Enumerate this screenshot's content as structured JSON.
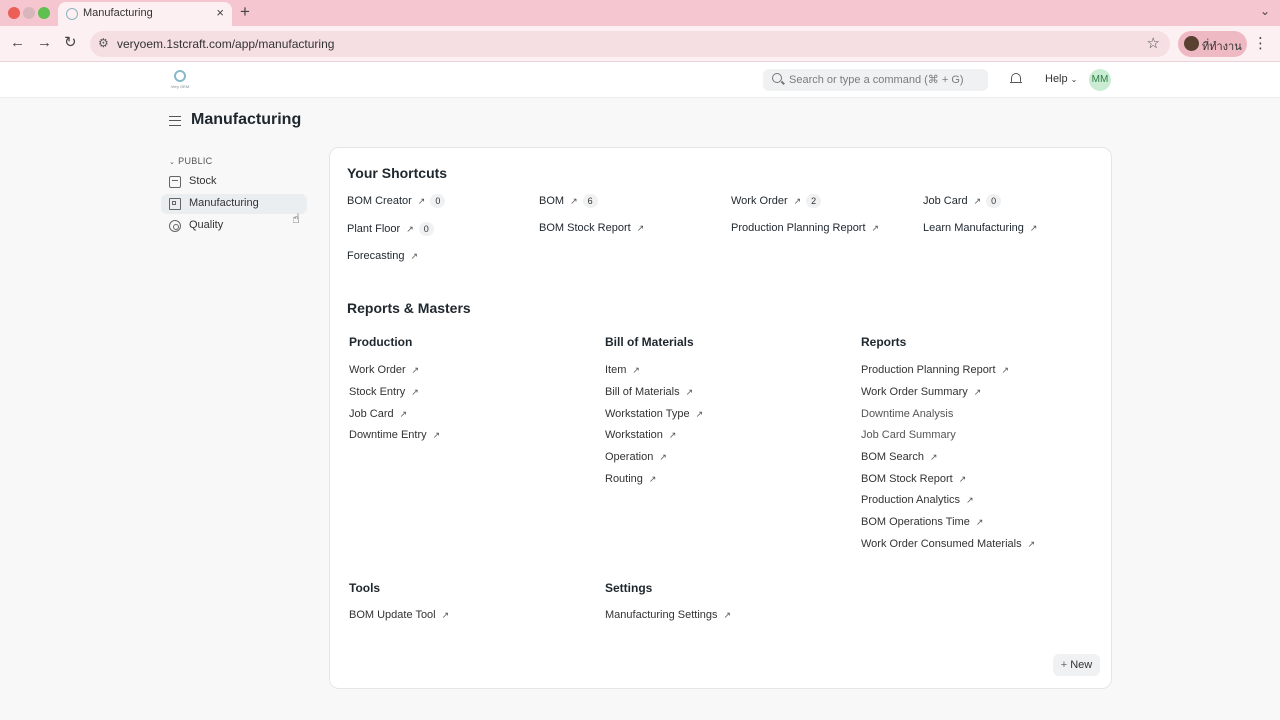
{
  "browser": {
    "tab_title": "Manufacturing",
    "tab_close": "×",
    "new_tab": "+",
    "tab_menu": "⌄",
    "url": "veryoem.1stcraft.com/app/manufacturing",
    "profile_label": "ที่ทำงาน",
    "back_icon": "←",
    "forward_icon": "→",
    "reload_icon": "↻",
    "star_icon": "☆",
    "menu_icon": "⋮",
    "site_icon": "⚙"
  },
  "navbar": {
    "logo_text": "Very OEM",
    "search_placeholder": "Search or type a command (⌘ + G)",
    "help_label": "Help",
    "avatar_initials": "MM"
  },
  "page": {
    "title": "Manufacturing"
  },
  "sidebar": {
    "section_label": "PUBLIC",
    "items": [
      {
        "label": "Stock",
        "icon": "box-icon",
        "active": false
      },
      {
        "label": "Manufacturing",
        "icon": "building-icon",
        "active": true
      },
      {
        "label": "Quality",
        "icon": "quality-icon",
        "active": false
      }
    ]
  },
  "shortcuts": {
    "heading": "Your Shortcuts",
    "items": [
      {
        "label": "BOM Creator",
        "count": "0"
      },
      {
        "label": "BOM",
        "count": "6"
      },
      {
        "label": "Work Order",
        "count": "2"
      },
      {
        "label": "Job Card",
        "count": "0"
      },
      {
        "label": "Plant Floor",
        "count": "0"
      },
      {
        "label": "BOM Stock Report",
        "count": null
      },
      {
        "label": "Production Planning Report",
        "count": null
      },
      {
        "label": "Learn Manufacturing",
        "count": null
      },
      {
        "label": "Forecasting",
        "count": null
      }
    ]
  },
  "reports": {
    "heading": "Reports & Masters",
    "columns": [
      {
        "title": "Production",
        "links": [
          {
            "label": "Work Order",
            "arrow": true
          },
          {
            "label": "Stock Entry",
            "arrow": true
          },
          {
            "label": "Job Card",
            "arrow": true
          },
          {
            "label": "Downtime Entry",
            "arrow": true
          }
        ]
      },
      {
        "title": "Bill of Materials",
        "links": [
          {
            "label": "Item",
            "arrow": true
          },
          {
            "label": "Bill of Materials",
            "arrow": true
          },
          {
            "label": "Workstation Type",
            "arrow": true
          },
          {
            "label": "Workstation",
            "arrow": true
          },
          {
            "label": "Operation",
            "arrow": true
          },
          {
            "label": "Routing",
            "arrow": true
          }
        ]
      },
      {
        "title": "Reports",
        "links": [
          {
            "label": "Production Planning Report",
            "arrow": true
          },
          {
            "label": "Work Order Summary",
            "arrow": true
          },
          {
            "label": "Downtime Analysis",
            "arrow": false
          },
          {
            "label": "Job Card Summary",
            "arrow": false
          },
          {
            "label": "BOM Search",
            "arrow": true
          },
          {
            "label": "BOM Stock Report",
            "arrow": true
          },
          {
            "label": "Production Analytics",
            "arrow": true
          },
          {
            "label": "BOM Operations Time",
            "arrow": true
          },
          {
            "label": "Work Order Consumed Materials",
            "arrow": true
          }
        ]
      },
      {
        "title": "Tools",
        "links": [
          {
            "label": "BOM Update Tool",
            "arrow": true
          }
        ]
      },
      {
        "title": "Settings",
        "links": [
          {
            "label": "Manufacturing Settings",
            "arrow": true
          }
        ]
      }
    ]
  },
  "actions": {
    "new_label": "New",
    "new_icon": "+",
    "link_arrow": "↗",
    "section_chevron": "⌄",
    "help_chevron": "⌄"
  },
  "colors": {
    "tabbar": "#f5c6cf",
    "chrome": "#fdf0f2",
    "accent_avatar": "#c9ecd2"
  }
}
